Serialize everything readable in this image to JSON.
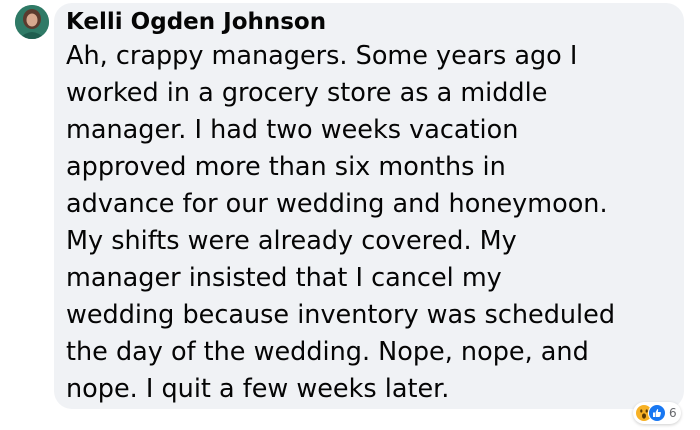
{
  "comment": {
    "author": "Kelli Ogden Johnson",
    "lines": [
      "Ah, crappy managers. Some years ago I",
      "worked in a grocery store as a middle",
      "manager. I had two weeks vacation",
      "approved more than six months in",
      "advance for our wedding and honeymoon.",
      "My shifts were already covered. My",
      "manager insisted that I cancel my",
      "wedding because inventory was scheduled",
      "the day of the wedding. Nope, nope, and",
      "nope. I quit a few weeks later."
    ],
    "reactions": {
      "icons": [
        "wow-reaction-icon",
        "like-reaction-icon"
      ],
      "count": "6"
    }
  },
  "colors": {
    "bubble": "#f0f2f5",
    "text": "#050505",
    "like": "#1877f2",
    "wow": "#f7b125"
  }
}
